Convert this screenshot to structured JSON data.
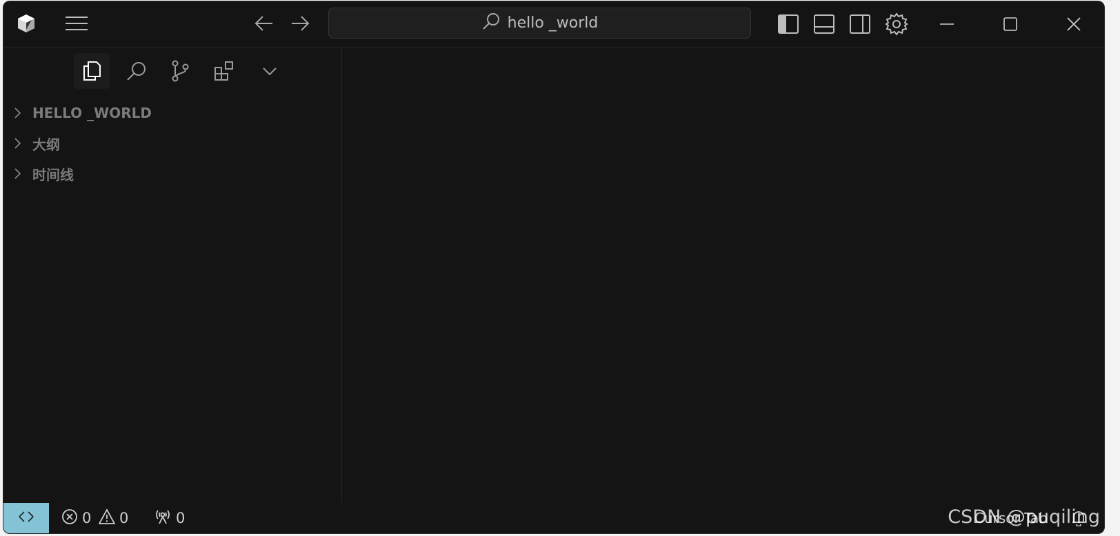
{
  "titlebar": {
    "command_center_text": "hello _world",
    "icons": [
      "cursor-logo-icon",
      "menu-icon",
      "arrow-left-icon",
      "arrow-right-icon",
      "search-icon",
      "toggle-primary-sidebar-icon",
      "toggle-panel-icon",
      "toggle-secondary-sidebar-icon",
      "gear-icon",
      "minimize-icon",
      "maximize-icon",
      "close-icon"
    ]
  },
  "activity_bar": {
    "icons": [
      "explorer-icon",
      "search-icon",
      "source-control-icon",
      "extensions-icon",
      "chevron-down-icon"
    ]
  },
  "sidebar": {
    "sections": [
      {
        "label": "HELLO _WORLD"
      },
      {
        "label": "大纲"
      },
      {
        "label": "时间线"
      }
    ]
  },
  "statusbar": {
    "errors": "0",
    "warnings": "0",
    "ports": "0",
    "cursor_tab": "Cursor Tab"
  },
  "watermark": "CSDN @puqiling",
  "colors": {
    "background": "#141414",
    "remote_indicator": "#84c3d6",
    "section_text": "#7b7b7b"
  }
}
